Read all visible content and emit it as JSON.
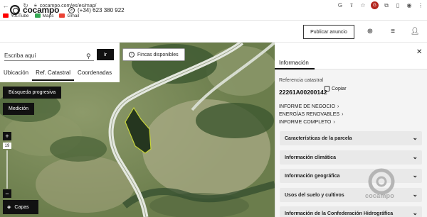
{
  "browser": {
    "url": "cocampo.com/es/es/map/",
    "bookmarks": [
      {
        "label": "YouTube",
        "color": "#ff0000"
      },
      {
        "label": "Maps",
        "color": "#34a853"
      },
      {
        "label": "Gmail",
        "color": "#ea4335"
      }
    ],
    "profile_badge": "G"
  },
  "header": {
    "logo_text": "cocampo",
    "phone": "(+34) 623 380 922",
    "publish_label": "Publicar anuncio"
  },
  "search": {
    "placeholder": "Escriba aquí",
    "go_label": "Ir",
    "tabs": [
      "Ubicación",
      "Ref. Catastral",
      "Coordenadas"
    ],
    "active_tab": "Ref. Catastral"
  },
  "map": {
    "fincas_label": "Fincas disponibles",
    "busqueda_label": "Búsqueda progresiva",
    "medicion_label": "Medición",
    "zoom_in": "+",
    "zoom_level": "19",
    "zoom_out": "−",
    "capas_label": "Capas",
    "colors": {
      "terrain": "#7d8f5e",
      "road": "#dfe4da",
      "parcel": "#c7d43a"
    }
  },
  "panel": {
    "tab_label": "Información",
    "ref_label": "Referencia catastral",
    "ref_value": "22261A00200142",
    "copy_label": "Copiar",
    "links": [
      "INFORME DE NEGOCIO",
      "ENERGÍAS RENOVABLES",
      "INFORME COMPLETO"
    ],
    "sections": [
      "Características de la parcela",
      "Información climática",
      "Información geográfica",
      "Usos del suelo y cultivos",
      "Información de la Confederación Hidrográfica"
    ],
    "watermark": "cocampo"
  }
}
